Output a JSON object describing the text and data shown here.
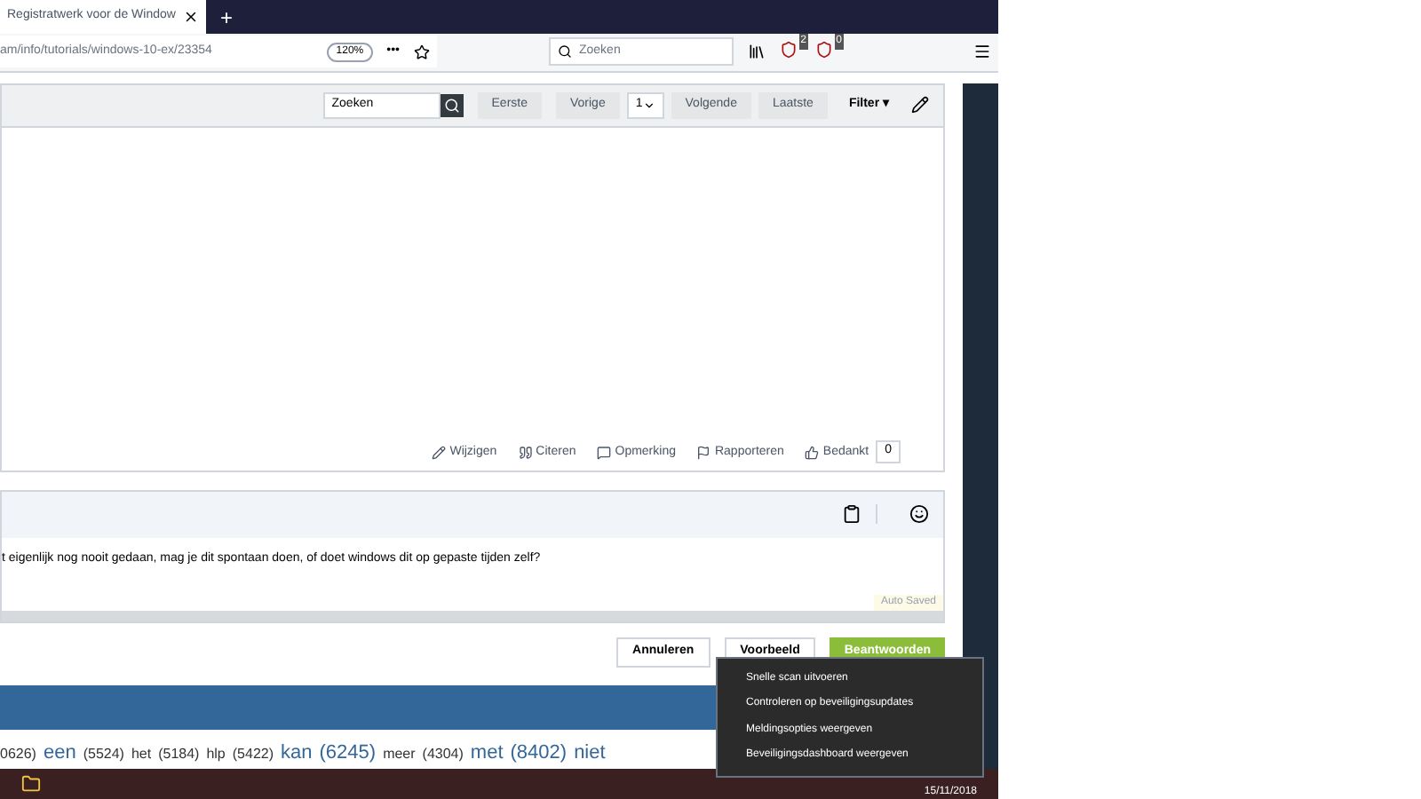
{
  "browser": {
    "tab_title": "Registratwerk voor de Window",
    "new_tab": "+",
    "url": "am/info/tutorials/windows-10-ex/23354",
    "zoom": "120%",
    "more": "•••",
    "search_placeholder": "Zoeken",
    "badges": [
      "2",
      "0"
    ]
  },
  "toolbar": {
    "search_placeholder": "Zoeken",
    "buttons": [
      "Eerste",
      "Vorige"
    ],
    "page": "1",
    "buttons_after": [
      "Volgende",
      "Laatste"
    ],
    "filter": "Filter ▾"
  },
  "post_actions": [
    "Wijzigen",
    "Citeren",
    "Opmerking",
    "Rapporteren",
    "Bedankt"
  ],
  "thanks_count": "0",
  "editor": {
    "text": "t eigenlijk nog nooit gedaan, mag je dit spontaan doen, of doet windows dit op gepaste tijden zelf?",
    "autosave": "Auto Saved"
  },
  "form_buttons": [
    {
      "label": "Annuleren",
      "primary": false
    },
    {
      "label": "Voorbeeld",
      "primary": false
    },
    {
      "label": "Beantwoorden",
      "primary": true
    }
  ],
  "tags": [
    {
      "word": "0626)",
      "big": false
    },
    {
      "word": "een",
      "big": true
    },
    {
      "word": "(5524)",
      "big": false
    },
    {
      "word": "het",
      "big": false
    },
    {
      "word": "(5184)",
      "big": false
    },
    {
      "word": "hlp",
      "big": false
    },
    {
      "word": "(5422)",
      "big": false
    },
    {
      "word": "kan",
      "big": true
    },
    {
      "word": "(6245)",
      "big": true
    },
    {
      "word": "meer",
      "big": false
    },
    {
      "word": "(4304)",
      "big": false
    },
    {
      "word": "met",
      "big": true
    },
    {
      "word": "(8402)",
      "big": true
    },
    {
      "word": "niet",
      "big": true
    }
  ],
  "context_menu": [
    "Snelle scan uitvoeren",
    "Controleren op beveiligingsupdates",
    "Meldingsopties weergeven",
    "Beveiligingsdashboard weergeven"
  ],
  "clock": "15/11/2018"
}
